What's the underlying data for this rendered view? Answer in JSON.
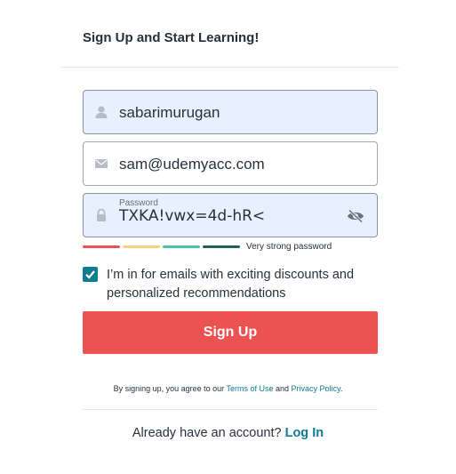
{
  "form": {
    "title": "Sign Up and Start Learning!",
    "name_field": {
      "value": "sabarimurugan",
      "icon": "user-icon"
    },
    "email_field": {
      "value": "sam@udemyacc.com",
      "icon": "envelope-icon"
    },
    "password_field": {
      "label": "Password",
      "value": "TXKA!vwx=4d-hR<",
      "icon": "lock-icon",
      "toggle_icon": "eye-slash-icon"
    },
    "strength": {
      "text": "Very strong password",
      "level": 4,
      "colors": [
        "#ec5252",
        "#f4d37f",
        "#4fc1a1",
        "#1e6055"
      ]
    },
    "newsletter": {
      "checked": true,
      "label": "I’m in for emails with exciting discounts and personalized recommendations"
    },
    "submit_label": "Sign Up",
    "terms": {
      "prefix": "By signing up, you agree to our ",
      "terms_link": "Terms of Use",
      "middle": " and ",
      "privacy_link": "Privacy Policy",
      "suffix": "."
    },
    "login": {
      "prompt": "Already have an account? ",
      "link": "Log In"
    }
  },
  "colors": {
    "accent": "#0f7c90",
    "button": "#ec5252",
    "autofill_bg": "#e8f0fe"
  }
}
